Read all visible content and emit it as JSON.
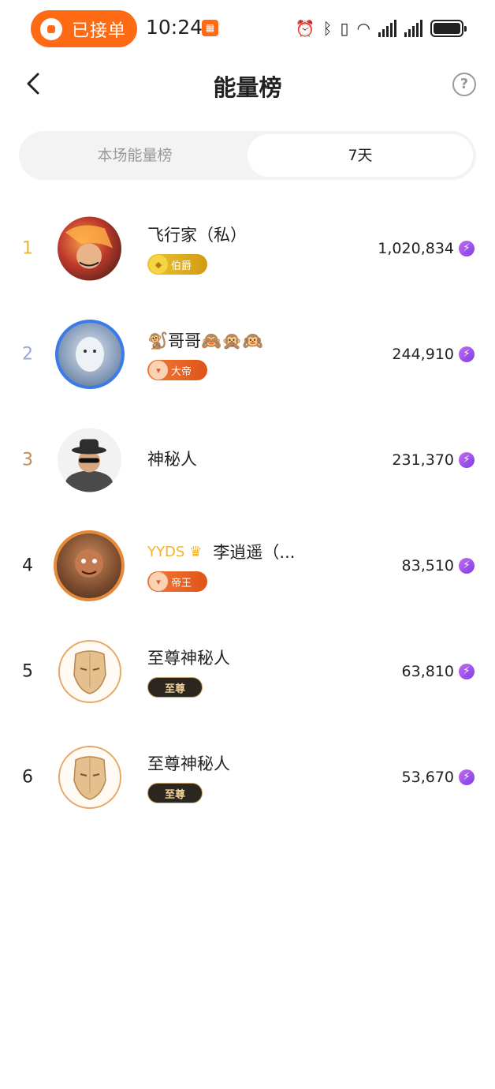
{
  "status_bar": {
    "order_label": "已接单",
    "time": "10:24",
    "app_badge_icon": "app-grid-icon"
  },
  "header": {
    "title": "能量榜",
    "help_label": "?"
  },
  "tabs": [
    {
      "label": "本场能量榜",
      "active": false
    },
    {
      "label": "7天",
      "active": true
    }
  ],
  "ranking": [
    {
      "rank": "1",
      "name": "飞行家（私）",
      "badge": "伯爵",
      "score": "1,020,834",
      "rank_color": "#f0b429"
    },
    {
      "rank": "2",
      "name": "🐒哥哥🙈🙊🙉",
      "badge": "大帝",
      "score": "244,910",
      "rank_color": "#9aa7d6"
    },
    {
      "rank": "3",
      "name": "神秘人",
      "badge": "",
      "score": "231,370",
      "rank_color": "#c8894f"
    },
    {
      "rank": "4",
      "name_prefix": "YYDS",
      "name": "李逍遥（...",
      "badge": "帝王",
      "score": "83,510",
      "rank_color": "#222222"
    },
    {
      "rank": "5",
      "name": "至尊神秘人",
      "badge": "至尊",
      "score": "63,810",
      "rank_color": "#222222"
    },
    {
      "rank": "6",
      "name": "至尊神秘人",
      "badge": "至尊",
      "score": "53,670",
      "rank_color": "#222222"
    }
  ],
  "colors": {
    "accent": "#ff6a14",
    "energy_icon": "#8b4be6"
  }
}
